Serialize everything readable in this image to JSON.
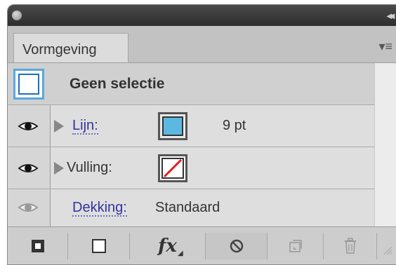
{
  "panel": {
    "tab_title": "Vormgeving",
    "collapse_glyph": "◂◂",
    "menu_glyph": "▾≡"
  },
  "selection": {
    "label": "Geen selectie"
  },
  "rows": {
    "stroke": {
      "label": "Lijn:",
      "value": "9 pt",
      "color": "#5cb8e0"
    },
    "fill": {
      "label": "Vulling:",
      "color": "none"
    },
    "opacity": {
      "label": "Dekking:",
      "value": "Standaard"
    }
  },
  "toolbar": {
    "fx_label": "fx"
  },
  "icons": [
    "eye-icon",
    "expand-triangle-icon",
    "add-stroke-icon",
    "add-fill-icon",
    "fx-icon",
    "clear-appearance-icon",
    "duplicate-item-icon",
    "delete-item-icon",
    "panel-menu-icon",
    "resize-grip-icon"
  ]
}
